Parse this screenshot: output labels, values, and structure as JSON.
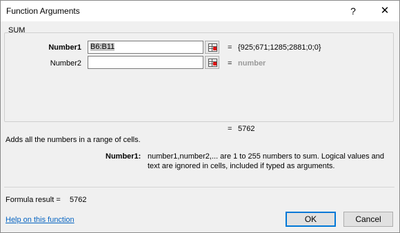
{
  "window": {
    "title": "Function Arguments",
    "help_glyph": "?",
    "close_glyph": "✕"
  },
  "function_name": "SUM",
  "args": [
    {
      "label": "Number1",
      "value": "B6:B11",
      "result": "{925;671;1285;2881;0;0}"
    },
    {
      "label": "Number2",
      "value": "",
      "result": "number"
    }
  ],
  "equals": "=",
  "total_result": "5762",
  "description": "Adds all the numbers in a range of cells.",
  "arg_help": {
    "label": "Number1:",
    "line1": "number1,number2,... are 1 to 255 numbers to sum. Logical values and",
    "line2": "text are ignored in cells, included if typed as arguments."
  },
  "formula_result": {
    "label": "Formula result =",
    "value": "5762"
  },
  "help_link": "Help on this function",
  "buttons": {
    "ok": "OK",
    "cancel": "Cancel"
  },
  "icons": {
    "ref_button": "range-select-icon"
  }
}
